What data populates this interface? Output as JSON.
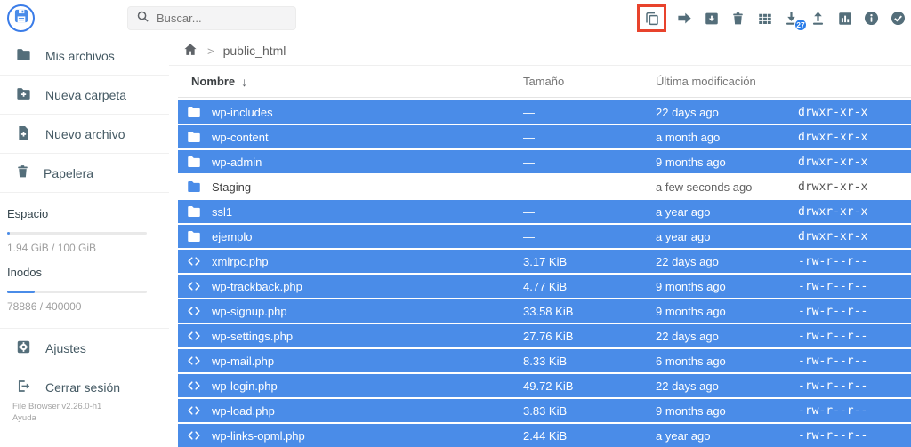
{
  "topbar": {
    "logo_icon": "file-browser-logo",
    "search": {
      "icon": "search-icon",
      "placeholder": "Buscar..."
    },
    "toolbar": {
      "copy": {
        "icon": "copy-icon",
        "highlighted": true
      },
      "move": {
        "icon": "arrow-right-icon"
      },
      "archive": {
        "icon": "archive-icon"
      },
      "delete": {
        "icon": "trash-icon"
      },
      "view": {
        "icon": "grid-view-icon"
      },
      "download": {
        "icon": "download-icon",
        "badge": "27"
      },
      "upload": {
        "icon": "upload-icon"
      },
      "stats": {
        "icon": "bar-chart-icon"
      },
      "info": {
        "icon": "info-icon"
      },
      "select_all": {
        "icon": "check-circle-icon"
      }
    }
  },
  "sidebar": {
    "items": [
      {
        "label": "Mis archivos",
        "icon": "folder-icon"
      },
      {
        "label": "Nueva carpeta",
        "icon": "new-folder-icon"
      },
      {
        "label": "Nuevo archivo",
        "icon": "new-file-icon"
      },
      {
        "label": "Papelera",
        "icon": "trash-icon"
      }
    ],
    "usage": [
      {
        "label": "Espacio",
        "value": "1.94 GiB / 100 GiB",
        "percent": 2
      },
      {
        "label": "Inodos",
        "value": "78886 / 400000",
        "percent": 20
      }
    ],
    "actions": [
      {
        "label": "Ajustes",
        "icon": "settings-icon"
      },
      {
        "label": "Cerrar sesión",
        "icon": "logout-icon"
      }
    ],
    "footer": {
      "version": "File Browser v2.26.0-h1",
      "help": "Ayuda"
    }
  },
  "main": {
    "breadcrumb": {
      "home_icon": "home-icon",
      "path": "public_html"
    },
    "table": {
      "headers": {
        "name": "Nombre",
        "size": "Tamaño",
        "modified": "Última modificación"
      },
      "rows": [
        {
          "name": "wp-includes",
          "type": "folder",
          "size": "—",
          "modified": "22 days ago",
          "perms": "drwxr-xr-x",
          "selected": true
        },
        {
          "name": "wp-content",
          "type": "folder",
          "size": "—",
          "modified": "a month ago",
          "perms": "drwxr-xr-x",
          "selected": true
        },
        {
          "name": "wp-admin",
          "type": "folder",
          "size": "—",
          "modified": "9 months ago",
          "perms": "drwxr-xr-x",
          "selected": true
        },
        {
          "name": "Staging",
          "type": "folder",
          "size": "—",
          "modified": "a few seconds ago",
          "perms": "drwxr-xr-x",
          "selected": false
        },
        {
          "name": "ssl1",
          "type": "folder",
          "size": "—",
          "modified": "a year ago",
          "perms": "drwxr-xr-x",
          "selected": true
        },
        {
          "name": "ejemplo",
          "type": "folder",
          "size": "—",
          "modified": "a year ago",
          "perms": "drwxr-xr-x",
          "selected": true
        },
        {
          "name": "xmlrpc.php",
          "type": "code",
          "size": "3.17 KiB",
          "modified": "22 days ago",
          "perms": "-rw-r--r--",
          "selected": true
        },
        {
          "name": "wp-trackback.php",
          "type": "code",
          "size": "4.77 KiB",
          "modified": "9 months ago",
          "perms": "-rw-r--r--",
          "selected": true
        },
        {
          "name": "wp-signup.php",
          "type": "code",
          "size": "33.58 KiB",
          "modified": "9 months ago",
          "perms": "-rw-r--r--",
          "selected": true
        },
        {
          "name": "wp-settings.php",
          "type": "code",
          "size": "27.76 KiB",
          "modified": "22 days ago",
          "perms": "-rw-r--r--",
          "selected": true
        },
        {
          "name": "wp-mail.php",
          "type": "code",
          "size": "8.33 KiB",
          "modified": "6 months ago",
          "perms": "-rw-r--r--",
          "selected": true
        },
        {
          "name": "wp-login.php",
          "type": "code",
          "size": "49.72 KiB",
          "modified": "22 days ago",
          "perms": "-rw-r--r--",
          "selected": true
        },
        {
          "name": "wp-load.php",
          "type": "code",
          "size": "3.83 KiB",
          "modified": "9 months ago",
          "perms": "-rw-r--r--",
          "selected": true
        },
        {
          "name": "wp-links-opml.php",
          "type": "code",
          "size": "2.44 KiB",
          "modified": "a year ago",
          "perms": "-rw-r--r--",
          "selected": true
        }
      ]
    }
  },
  "colors": {
    "accent_blue": "#4a8ce8",
    "selected_row_blue": "#4a8ce8",
    "icon_gray": "#546e7a",
    "highlight_red": "#e8432c",
    "badge_blue": "#2b7de9"
  }
}
